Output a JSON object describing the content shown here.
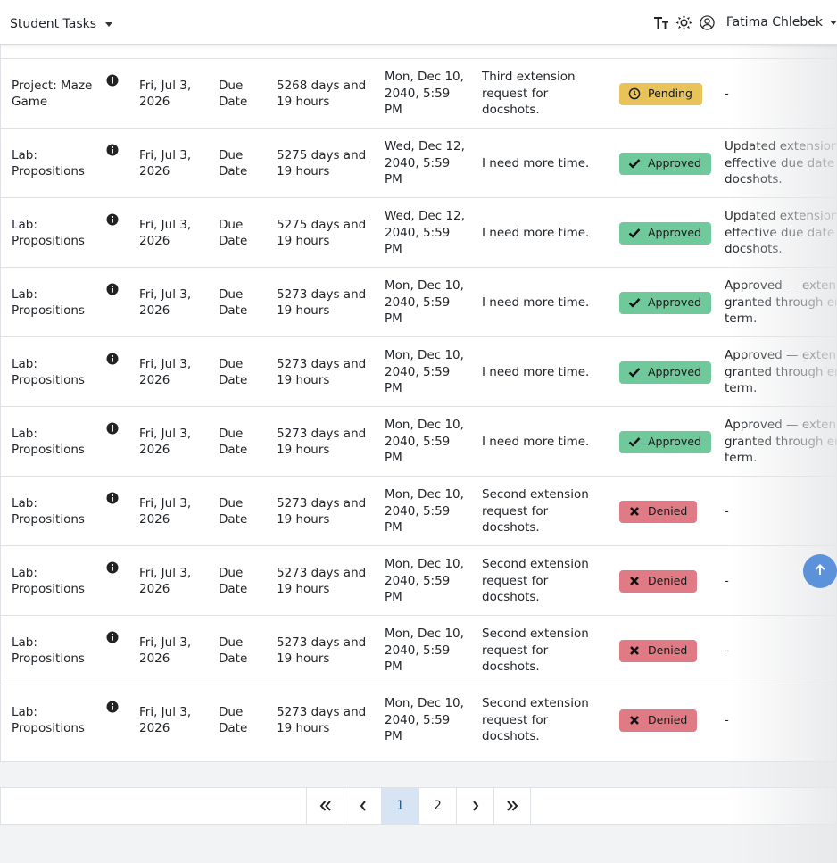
{
  "header": {
    "title": "Student Tasks",
    "user_name": "Fatima Chlebek",
    "icons": [
      "text-size-icon",
      "theme-sun-icon",
      "user-circle-icon"
    ]
  },
  "colors": {
    "pending": "#e8c35a",
    "approved": "#6fc99a",
    "denied": "#e07a84",
    "active_page": "#d6e4f3",
    "scroll_button": "#5b92d9"
  },
  "rows": [
    {
      "name": [
        "Project: Maze",
        "Game"
      ],
      "date": [
        "Fri, Jul 3,",
        "2026"
      ],
      "type": [
        "Due",
        "Date"
      ],
      "remaining": [
        "5268 days and",
        "19 hours"
      ],
      "requested": [
        "Mon, Dec 10,",
        "2040, 5:59",
        "PM"
      ],
      "reason": [
        "Third extension",
        "request for",
        "docshots."
      ],
      "status": "Pending",
      "status_kind": "pending",
      "response": [
        "-"
      ]
    },
    {
      "name": [
        "Lab:",
        "Propositions"
      ],
      "date": [
        "Fri, Jul 3,",
        "2026"
      ],
      "type": [
        "Due",
        "Date"
      ],
      "remaining": [
        "5275 days and",
        "19 hours"
      ],
      "requested": [
        "Wed, Dec 12,",
        "2040, 5:59",
        "PM"
      ],
      "reason": [
        "I need more time."
      ],
      "status": "Approved",
      "status_kind": "approved",
      "response": [
        "Updated extension",
        "effective due date t",
        "docshots."
      ]
    },
    {
      "name": [
        "Lab:",
        "Propositions"
      ],
      "date": [
        "Fri, Jul 3,",
        "2026"
      ],
      "type": [
        "Due",
        "Date"
      ],
      "remaining": [
        "5275 days and",
        "19 hours"
      ],
      "requested": [
        "Wed, Dec 12,",
        "2040, 5:59",
        "PM"
      ],
      "reason": [
        "I need more time."
      ],
      "status": "Approved",
      "status_kind": "approved",
      "response": [
        "Updated extension",
        "effective due date t",
        "docshots."
      ]
    },
    {
      "name": [
        "Lab:",
        "Propositions"
      ],
      "date": [
        "Fri, Jul 3,",
        "2026"
      ],
      "type": [
        "Due",
        "Date"
      ],
      "remaining": [
        "5273 days and",
        "19 hours"
      ],
      "requested": [
        "Mon, Dec 10,",
        "2040, 5:59",
        "PM"
      ],
      "reason": [
        "I need more time."
      ],
      "status": "Approved",
      "status_kind": "approved",
      "response": [
        "Approved — extens",
        "granted through en",
        "term."
      ]
    },
    {
      "name": [
        "Lab:",
        "Propositions"
      ],
      "date": [
        "Fri, Jul 3,",
        "2026"
      ],
      "type": [
        "Due",
        "Date"
      ],
      "remaining": [
        "5273 days and",
        "19 hours"
      ],
      "requested": [
        "Mon, Dec 10,",
        "2040, 5:59",
        "PM"
      ],
      "reason": [
        "I need more time."
      ],
      "status": "Approved",
      "status_kind": "approved",
      "response": [
        "Approved — extens",
        "granted through en",
        "term."
      ]
    },
    {
      "name": [
        "Lab:",
        "Propositions"
      ],
      "date": [
        "Fri, Jul 3,",
        "2026"
      ],
      "type": [
        "Due",
        "Date"
      ],
      "remaining": [
        "5273 days and",
        "19 hours"
      ],
      "requested": [
        "Mon, Dec 10,",
        "2040, 5:59",
        "PM"
      ],
      "reason": [
        "I need more time."
      ],
      "status": "Approved",
      "status_kind": "approved",
      "response": [
        "Approved — extens",
        "granted through en",
        "term."
      ]
    },
    {
      "name": [
        "Lab:",
        "Propositions"
      ],
      "date": [
        "Fri, Jul 3,",
        "2026"
      ],
      "type": [
        "Due",
        "Date"
      ],
      "remaining": [
        "5273 days and",
        "19 hours"
      ],
      "requested": [
        "Mon, Dec 10,",
        "2040, 5:59",
        "PM"
      ],
      "reason": [
        "Second extension",
        "request for",
        "docshots."
      ],
      "status": "Denied",
      "status_kind": "denied",
      "response": [
        "-"
      ]
    },
    {
      "name": [
        "Lab:",
        "Propositions"
      ],
      "date": [
        "Fri, Jul 3,",
        "2026"
      ],
      "type": [
        "Due",
        "Date"
      ],
      "remaining": [
        "5273 days and",
        "19 hours"
      ],
      "requested": [
        "Mon, Dec 10,",
        "2040, 5:59",
        "PM"
      ],
      "reason": [
        "Second extension",
        "request for",
        "docshots."
      ],
      "status": "Denied",
      "status_kind": "denied",
      "response": [
        "-"
      ]
    },
    {
      "name": [
        "Lab:",
        "Propositions"
      ],
      "date": [
        "Fri, Jul 3,",
        "2026"
      ],
      "type": [
        "Due",
        "Date"
      ],
      "remaining": [
        "5273 days and",
        "19 hours"
      ],
      "requested": [
        "Mon, Dec 10,",
        "2040, 5:59",
        "PM"
      ],
      "reason": [
        "Second extension",
        "request for",
        "docshots."
      ],
      "status": "Denied",
      "status_kind": "denied",
      "response": [
        "-"
      ]
    },
    {
      "name": [
        "Lab:",
        "Propositions"
      ],
      "date": [
        "Fri, Jul 3,",
        "2026"
      ],
      "type": [
        "Due",
        "Date"
      ],
      "remaining": [
        "5273 days and",
        "19 hours"
      ],
      "requested": [
        "Mon, Dec 10,",
        "2040, 5:59",
        "PM"
      ],
      "reason": [
        "Second extension",
        "request for",
        "docshots."
      ],
      "status": "Denied",
      "status_kind": "denied",
      "response": [
        "-"
      ]
    }
  ],
  "pagination": {
    "first_icon": "double-chevron-left-icon",
    "prev_icon": "chevron-left-icon",
    "pages": [
      "1",
      "2"
    ],
    "active_page": "1",
    "next_icon": "chevron-right-icon",
    "last_icon": "double-chevron-right-icon"
  },
  "scroll_top_icon": "arrow-up-icon"
}
